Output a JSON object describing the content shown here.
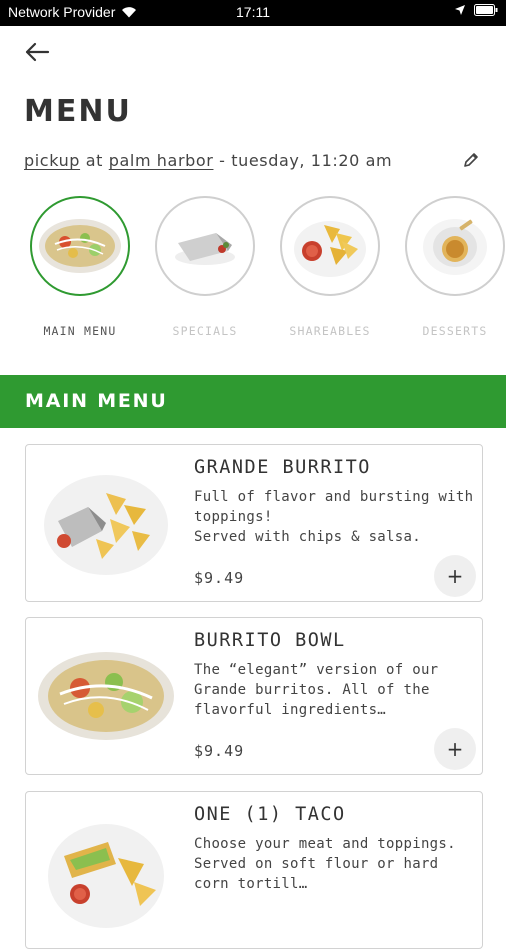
{
  "status_bar": {
    "carrier": "Network Provider",
    "time": "17:11"
  },
  "header": {
    "title": "MENU"
  },
  "pickup": {
    "mode": "pickup",
    "connector": " at ",
    "location": "palm harbor",
    "datetime": " - tuesday, 11:20 am"
  },
  "categories": [
    {
      "label": "MAIN MENU",
      "icon": "burrito-bowl-icon",
      "active": true
    },
    {
      "label": "SPECIALS",
      "icon": "burrito-icon",
      "active": false
    },
    {
      "label": "SHAREABLES",
      "icon": "chips-salsa-icon",
      "active": false
    },
    {
      "label": "DESSERTS",
      "icon": "flan-icon",
      "active": false
    }
  ],
  "section": {
    "title": "MAIN MENU"
  },
  "items": [
    {
      "name": "GRANDE BURRITO",
      "description": "Full of flavor and bursting with toppings!\nServed with chips & salsa.",
      "price": "$9.49",
      "add_label": "+"
    },
    {
      "name": "BURRITO BOWL",
      "description": "The “elegant” version of our Grande burritos. All of the flavorful ingredients…",
      "price": "$9.49",
      "add_label": "+"
    },
    {
      "name": "ONE (1) TACO",
      "description": "Choose your meat and toppings. Served on soft flour or hard corn tortill…",
      "price": "",
      "add_label": ""
    }
  ],
  "colors": {
    "accent": "#2f9a31",
    "status_bar": "#000000",
    "card_border": "#d2d2d2"
  }
}
